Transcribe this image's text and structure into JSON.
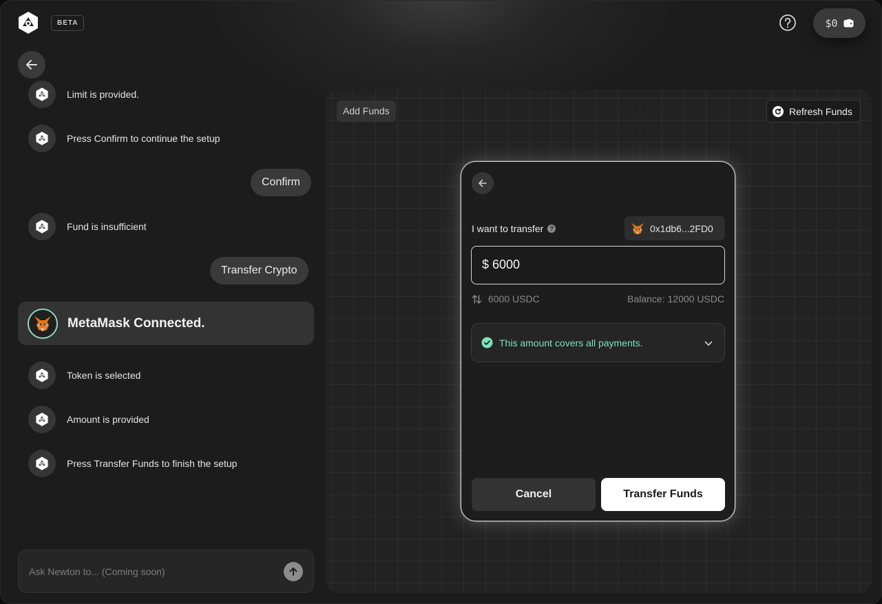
{
  "header": {
    "badge": "BETA",
    "help_icon": "help-circle-icon",
    "wallet_balance": "$0",
    "wallet_icon": "wallet-icon"
  },
  "chat": {
    "messages": [
      {
        "from": "bot",
        "text": "Limit is provided."
      },
      {
        "from": "bot",
        "text": "Press Confirm to continue the setup"
      },
      {
        "from": "user",
        "text": "Confirm"
      },
      {
        "from": "bot",
        "text": "Fund is insufficient"
      },
      {
        "from": "user",
        "text": "Transfer Crypto"
      },
      {
        "from": "status",
        "text": "MetaMask Connected."
      },
      {
        "from": "bot",
        "text": "Token is selected"
      },
      {
        "from": "bot",
        "text": "Amount is provided"
      },
      {
        "from": "bot",
        "text": "Press Transfer Funds to finish the setup"
      }
    ],
    "input_placeholder": "Ask Newton to... (Coming soon)"
  },
  "panel": {
    "title": "Add Funds",
    "refresh_label": "Refresh Funds"
  },
  "transfer_modal": {
    "label": "I want to transfer",
    "wallet_address": "0x1db6...2FD0",
    "amount": "$ 6000",
    "converted": "6000 USDC",
    "balance": "Balance: 12000 USDC",
    "coverage_message": "This amount covers all payments.",
    "cancel_label": "Cancel",
    "confirm_label": "Transfer Funds"
  },
  "colors": {
    "accent_success": "#7fe0bd",
    "metamask_orange": "#e2761b"
  }
}
